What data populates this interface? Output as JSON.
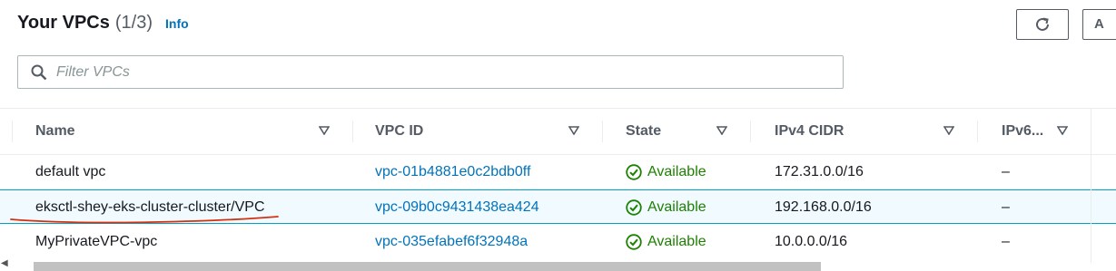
{
  "header": {
    "title": "Your VPCs",
    "count": "(1/3)",
    "info": "Info"
  },
  "toolbar": {
    "actions_label": "A"
  },
  "search": {
    "placeholder": "Filter VPCs",
    "value": ""
  },
  "columns": [
    "Name",
    "VPC ID",
    "State",
    "IPv4 CIDR",
    "IPv6..."
  ],
  "rows": [
    {
      "name": "default vpc",
      "vpc_id": "vpc-01b4881e0c2bdb0ff",
      "state": "Available",
      "ipv4": "172.31.0.0/16",
      "ipv6": "–",
      "selected": false
    },
    {
      "name": "eksctl-shey-eks-cluster-cluster/VPC",
      "vpc_id": "vpc-09b0c9431438ea424",
      "state": "Available",
      "ipv4": "192.168.0.0/16",
      "ipv6": "–",
      "selected": true
    },
    {
      "name": "MyPrivateVPC-vpc",
      "vpc_id": "vpc-035efabef6f32948a",
      "state": "Available",
      "ipv4": "10.0.0.0/16",
      "ipv6": "–",
      "selected": false
    }
  ],
  "colors": {
    "link": "#0073bb",
    "available": "#1d8102",
    "annotation": "#d13212"
  },
  "icons": {
    "refresh": "refresh-icon",
    "search": "search-icon",
    "sort": "sort-caret-icon",
    "status": "check-circle-icon"
  }
}
